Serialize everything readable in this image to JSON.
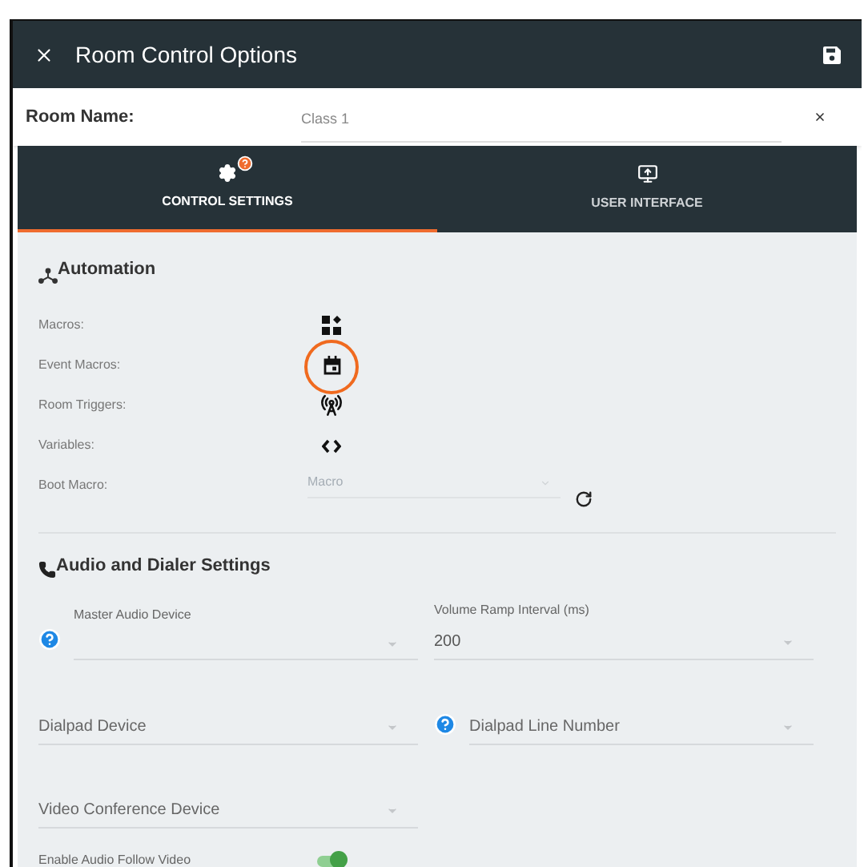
{
  "window": {
    "title": "Room Control Options"
  },
  "room_name": {
    "label": "Room Name:",
    "value": "Class 1"
  },
  "tabs": [
    {
      "label": "CONTROL SETTINGS",
      "help": true,
      "selected": true
    },
    {
      "label": "USER INTERFACE",
      "selected": false
    }
  ],
  "automation": {
    "title": "Automation",
    "items": [
      {
        "label": "Macros:",
        "kind": "icon",
        "highlighted": false
      },
      {
        "label": "Event Macros:",
        "kind": "icon",
        "highlighted": true
      },
      {
        "label": "Room Triggers:",
        "kind": "icon",
        "highlighted": false
      },
      {
        "label": "Variables:",
        "kind": "icon",
        "highlighted": false
      },
      {
        "label": "Boot Macro:",
        "kind": "select",
        "placeholder": "Macro"
      }
    ]
  },
  "audio": {
    "title": "Audio and Dialer Settings",
    "rows": [
      [
        {
          "label": "Master Audio Device",
          "help": true
        },
        {
          "label": "Volume Ramp Interval (ms)",
          "value": "200"
        }
      ],
      [
        {
          "placeholder": "Dialpad Device"
        },
        {
          "placeholder": "Dialpad Line Number",
          "help": true
        }
      ],
      [
        {
          "placeholder": "Video Conference Device"
        }
      ]
    ],
    "toggle": {
      "label": "Enable Audio Follow Video",
      "on": true
    }
  }
}
